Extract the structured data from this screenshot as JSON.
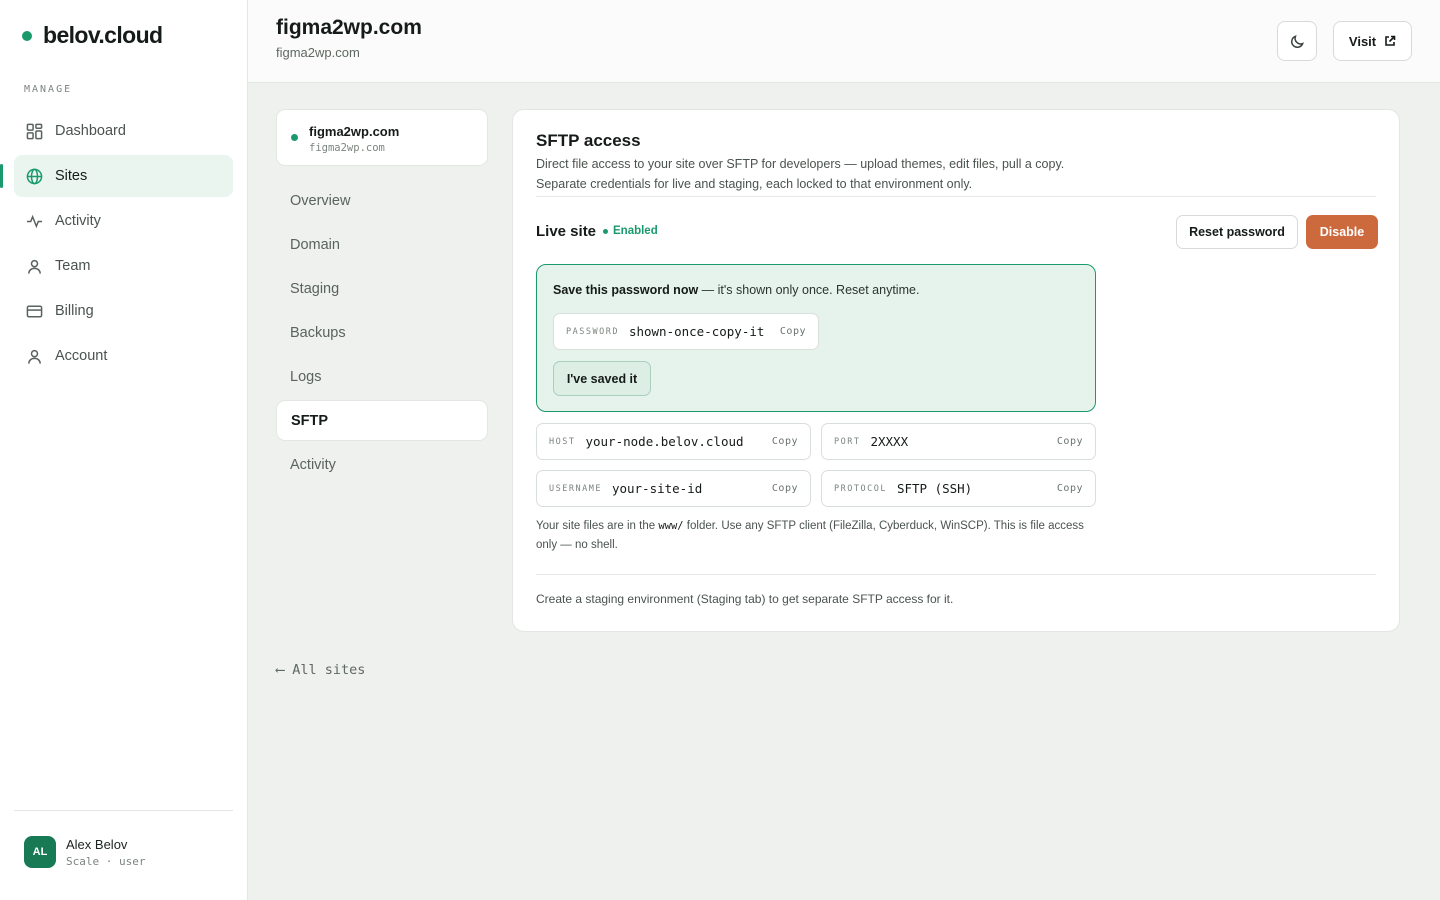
{
  "brand": {
    "name": "belov.cloud"
  },
  "sidebar": {
    "section_label": "MANAGE",
    "items": [
      {
        "label": "Dashboard",
        "icon": "grid-icon",
        "active": false
      },
      {
        "label": "Sites",
        "icon": "globe-icon",
        "active": true
      },
      {
        "label": "Activity",
        "icon": "pulse-icon",
        "active": false
      },
      {
        "label": "Team",
        "icon": "person-icon",
        "active": false
      },
      {
        "label": "Billing",
        "icon": "card-icon",
        "active": false
      },
      {
        "label": "Account",
        "icon": "person-icon",
        "active": false
      }
    ],
    "user": {
      "initials": "AL",
      "name": "Alex Belov",
      "plan": "Scale · user"
    }
  },
  "header": {
    "title": "figma2wp.com",
    "subtitle": "figma2wp.com",
    "visit_label": "Visit"
  },
  "site_card": {
    "name": "figma2wp.com",
    "slug": "figma2wp.com"
  },
  "subnav": {
    "items": [
      {
        "label": "Overview",
        "active": false
      },
      {
        "label": "Domain",
        "active": false
      },
      {
        "label": "Staging",
        "active": false
      },
      {
        "label": "Backups",
        "active": false
      },
      {
        "label": "Logs",
        "active": false
      },
      {
        "label": "SFTP",
        "active": true
      },
      {
        "label": "Activity",
        "active": false
      }
    ],
    "back_label": "⟵ All sites"
  },
  "sftp": {
    "title": "SFTP access",
    "desc_line1": "Direct file access to your site over SFTP for developers — upload themes, edit files, pull a copy.",
    "desc_line2": "Separate credentials for live and staging, each locked to that environment only.",
    "live_title": "Live site",
    "status": "Enabled",
    "reset_label": "Reset password",
    "disable_label": "Disable",
    "notice_bold": "Save this password now",
    "notice_rest": " — it's shown only once. Reset anytime.",
    "password_label": "PASSWORD",
    "password_value": "shown-once-copy-it",
    "copy_label": "Copy",
    "saved_label": "I've saved it",
    "fields": [
      {
        "label": "HOST",
        "value": "your-node.belov.cloud"
      },
      {
        "label": "PORT",
        "value": "2XXXX"
      },
      {
        "label": "USERNAME",
        "value": "your-site-id"
      },
      {
        "label": "PROTOCOL",
        "value": "SFTP (SSH)"
      }
    ],
    "help_pre": "Your site files are in the ",
    "help_code": "www/",
    "help_post": " folder. Use any SFTP client (FileZilla, Cyberduck, WinSCP). This is file access only — no shell.",
    "staging_note": "Create a staging environment (Staging tab) to get separate SFTP access for it."
  },
  "colors": {
    "accent": "#1a9a6c",
    "danger": "#cc6a3e",
    "background": "#eef1ee"
  }
}
